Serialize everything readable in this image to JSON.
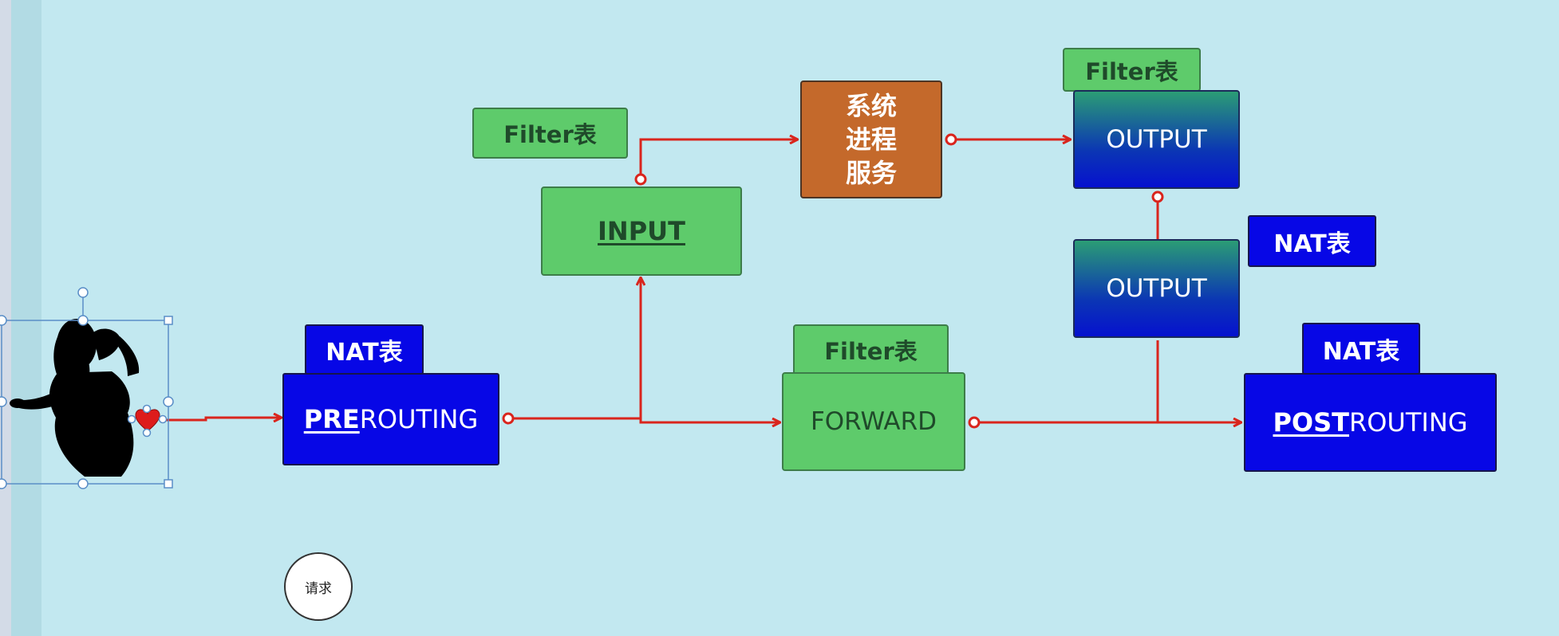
{
  "colors": {
    "background": "#c2e8f0",
    "chain_blue": "#0707e6",
    "table_green": "#5ecb6b",
    "process_orange": "#c4692b",
    "arrow_red": "#d9251d"
  },
  "nodes": {
    "prerouting": {
      "part1": "PRE",
      "part2": "ROUTING"
    },
    "input": {
      "label": "INPUT"
    },
    "forward": {
      "label": "FORWARD"
    },
    "system_process": {
      "line1": "系统",
      "line2": "进程",
      "line3": "服务"
    },
    "output_filter": {
      "label": "OUTPUT"
    },
    "output_nat": {
      "label": "OUTPUT"
    },
    "postrouting": {
      "part1": "POST",
      "part2": "ROUTING"
    }
  },
  "tables": {
    "nat_prerouting": "NAT表",
    "filter_input": "Filter表",
    "filter_forward": "Filter表",
    "filter_output": "Filter表",
    "nat_output": "NAT表",
    "nat_postrouting": "NAT表"
  },
  "request_label": "请求",
  "icons": {
    "client": "woman-silhouette-icon",
    "heart": "heart-icon"
  }
}
